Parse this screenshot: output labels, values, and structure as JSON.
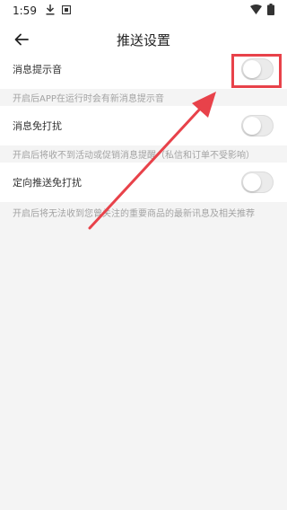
{
  "status_bar": {
    "time": "1:59",
    "icons": [
      "download-icon",
      "app-icon",
      "wifi-icon",
      "battery-icon"
    ]
  },
  "header": {
    "title": "推送设置",
    "back_icon": "back-arrow-icon"
  },
  "settings": [
    {
      "label": "消息提示音",
      "enabled": false,
      "hint": "开启后APP在运行时会有新消息提示音"
    },
    {
      "label": "消息免打扰",
      "enabled": false,
      "hint": "开启后将收不到活动或促销消息提醒（私信和订单不受影响）"
    },
    {
      "label": "定向推送免打扰",
      "enabled": false,
      "hint": "开启后将无法收到您曾关注的重要商品的最新讯息及相关推荐"
    }
  ],
  "annotation": {
    "color": "#e8424a",
    "type": "red-arrow-and-box"
  }
}
